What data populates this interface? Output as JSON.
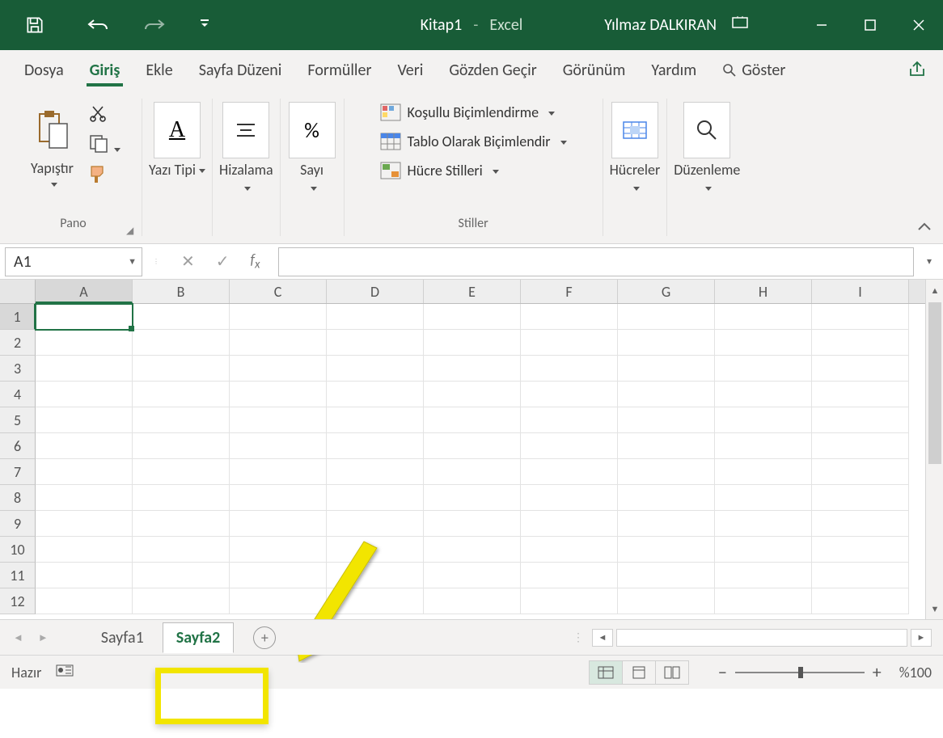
{
  "title": {
    "doc": "Kitap1",
    "sep": "-",
    "app": "Excel",
    "user": "Yılmaz DALKIRAN"
  },
  "tabs": {
    "file": "Dosya",
    "home": "Giriş",
    "insert": "Ekle",
    "layout": "Sayfa Düzeni",
    "formulas": "Formüller",
    "data": "Veri",
    "review": "Gözden Geçir",
    "view": "Görünüm",
    "help": "Yardım",
    "tell": "Göster"
  },
  "ribbon": {
    "clipboard": {
      "paste": "Yapıştır",
      "group": "Pano"
    },
    "font": {
      "label": "Yazı Tipi"
    },
    "align": {
      "label": "Hizalama"
    },
    "number": {
      "label": "Sayı"
    },
    "styles": {
      "cond": "Koşullu Biçimlendirme",
      "table": "Tablo Olarak Biçimlendir",
      "cell": "Hücre Stilleri",
      "group": "Stiller"
    },
    "cells": {
      "label": "Hücreler"
    },
    "editing": {
      "label": "Düzenleme"
    }
  },
  "namebox": "A1",
  "columns": [
    "A",
    "B",
    "C",
    "D",
    "E",
    "F",
    "G",
    "H",
    "I"
  ],
  "rows": [
    "1",
    "2",
    "3",
    "4",
    "5",
    "6",
    "7",
    "8",
    "9",
    "10",
    "11",
    "12"
  ],
  "sheets": {
    "s1": "Sayfa1",
    "s2": "Sayfa2"
  },
  "status": {
    "ready": "Hazır",
    "zoom": "%100"
  }
}
